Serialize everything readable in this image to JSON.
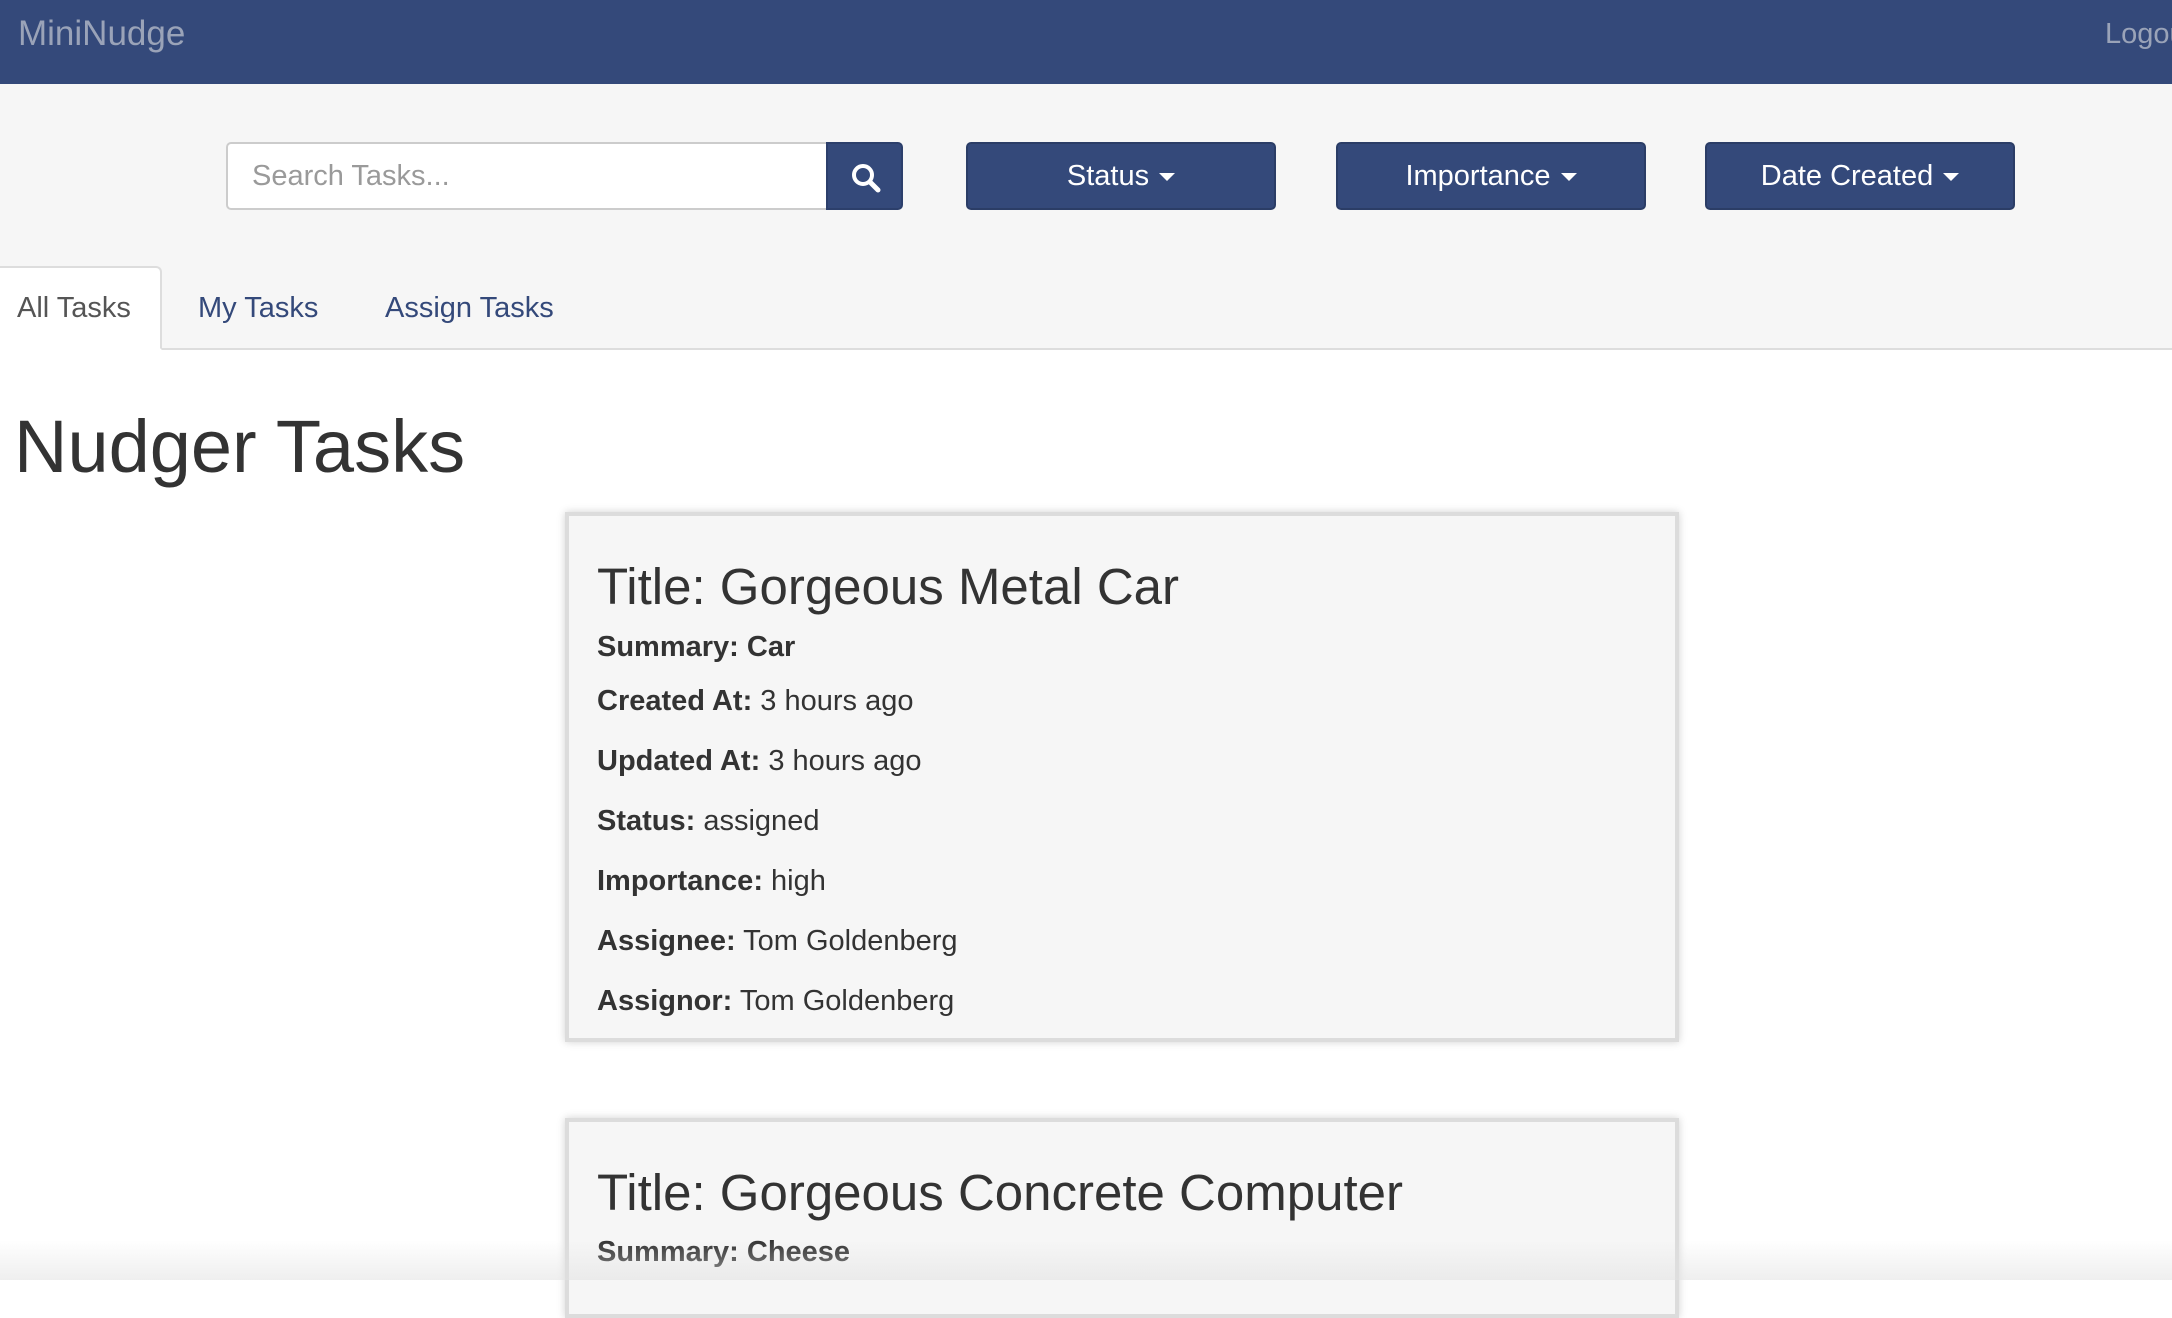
{
  "navbar": {
    "brand": "MiniNudge",
    "logout_label": "Logout"
  },
  "search": {
    "placeholder": "Search Tasks...",
    "button_icon": "search-icon"
  },
  "filters": [
    {
      "label": "Status",
      "icon": "caret-down-icon"
    },
    {
      "label": "Importance",
      "icon": "caret-down-icon"
    },
    {
      "label": "Date Created",
      "icon": "caret-down-icon"
    }
  ],
  "tabs": [
    {
      "label": "All Tasks",
      "active": true
    },
    {
      "label": "My Tasks",
      "active": false
    },
    {
      "label": "Assign Tasks",
      "active": false
    }
  ],
  "page_title": "Nudger Tasks",
  "labels": {
    "title": "Title:",
    "summary": "Summary:",
    "created_at": "Created At:",
    "updated_at": "Updated At:",
    "status": "Status:",
    "importance": "Importance:",
    "assignee": "Assignee:",
    "assignor": "Assignor:"
  },
  "tasks": [
    {
      "title": "Gorgeous Metal Car",
      "summary": "Car",
      "created_at": "3 hours ago",
      "updated_at": "3 hours ago",
      "status": "assigned",
      "importance": "high",
      "assignee": "Tom Goldenberg",
      "assignor": "Tom Goldenberg"
    },
    {
      "title": "Gorgeous Concrete Computer",
      "summary": "Cheese"
    }
  ],
  "colors": {
    "navbar": "#34497a",
    "toolbar_bg": "#f6f6f6",
    "link": "#34497a",
    "card_bg": "#f6f6f6"
  }
}
